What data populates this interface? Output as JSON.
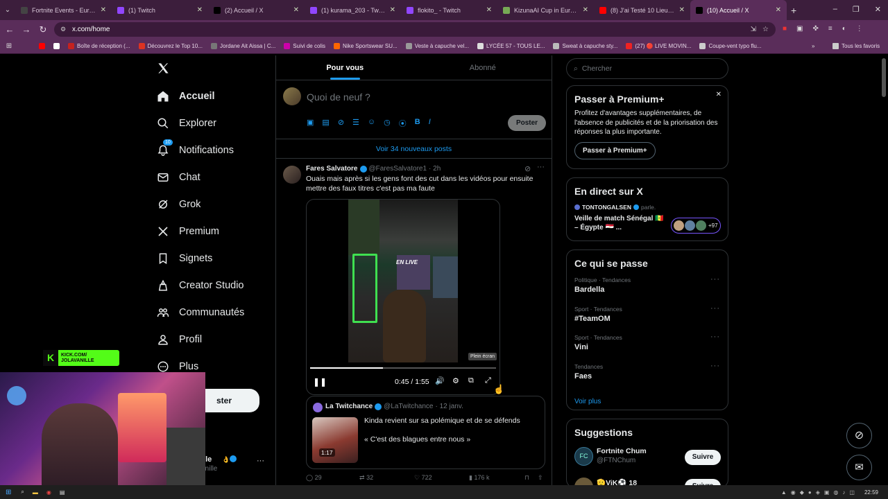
{
  "browser": {
    "tabs": [
      {
        "title": "Fortnite Events - Europe",
        "color": "#444"
      },
      {
        "title": "(1) Twitch",
        "color": "#9146ff"
      },
      {
        "title": "(2) Accueil / X",
        "color": "#000"
      },
      {
        "title": "(1) kurama_203 - Twitch",
        "color": "#9146ff"
      },
      {
        "title": "flokito_ - Twitch",
        "color": "#9146ff"
      },
      {
        "title": "KizunaAI Cup in Europe: 5",
        "color": "#7a5"
      },
      {
        "title": "(8) J'ai Testé 10 Lieux Not",
        "color": "#f00"
      },
      {
        "title": "(10) Accueil / X",
        "color": "#000"
      }
    ],
    "url": "x.com/home",
    "bookmarks": [
      "Boîte de réception (...",
      "Découvrez le Top 10...",
      "Jordane Ait Aissa | C...",
      "Suivi de colis",
      "Nike Sportswear SU...",
      "Veste à capuche vel...",
      "LYCÉE 57 - TOUS LE...",
      "Sweat à capuche sty...",
      "(27) 🔴 LIVE MOVIN...",
      "Coupe-vent typo flu..."
    ],
    "bookmarks_all": "Tous les favoris"
  },
  "nav": {
    "items": [
      {
        "label": "Accueil"
      },
      {
        "label": "Explorer"
      },
      {
        "label": "Notifications"
      },
      {
        "label": "Chat"
      },
      {
        "label": "Grok"
      },
      {
        "label": "Premium"
      },
      {
        "label": "Signets"
      },
      {
        "label": "Creator Studio"
      },
      {
        "label": "Communautés"
      },
      {
        "label": "Profil"
      },
      {
        "label": "Plus"
      }
    ],
    "notif_badge": "10",
    "post_button": "ster",
    "account_name": "ille",
    "account_handle": "anille"
  },
  "feed": {
    "tab_for_you": "Pour vous",
    "tab_following": "Abonné",
    "compose_placeholder": "Quoi de neuf ?",
    "post_button": "Poster",
    "new_posts": "Voir 34 nouveaux posts",
    "tweet": {
      "name": "Fares Salvatore",
      "handle": "@FaresSalvatore1",
      "time": "· 2h",
      "text": "Ouais mais après si les gens font des cut dans les vidéos pour ensuite mettre des faux titres c'est pas ma faute",
      "video_time": "0:45 / 1:55",
      "video_progress": 0.39,
      "tooltip": "Plein écran",
      "video_overlay": "EN LIVE",
      "quote": {
        "name": "La Twitchance",
        "handle": "@LaTwitchance",
        "date": "· 12 janv.",
        "line1": "Kinda revient sur sa polémique et de se défends",
        "line2": "« C'est des blagues entre nous »",
        "duration": "1:17"
      },
      "stats": {
        "replies": "29",
        "reposts": "32",
        "likes": "722",
        "views": "176 k"
      }
    }
  },
  "right": {
    "search_placeholder": "Chercher",
    "premium": {
      "title": "Passer à Premium+",
      "text": "Profitez d'avantages supplémentaires, de l'absence de publicités et de la priorisation des réponses la plus importante.",
      "button": "Passer à Premium+"
    },
    "live": {
      "title": "En direct sur X",
      "host": "TONTONGALSEN",
      "host_suffix": "parle.",
      "topic": "Veille de match Sénégal 🇸🇳 – Égypte 🇪🇬 ...",
      "count": "+97"
    },
    "trends": {
      "title": "Ce qui se passe",
      "items": [
        {
          "meta": "Politique · Tendances",
          "name": "Bardella"
        },
        {
          "meta": "Sport · Tendances",
          "name": "#TeamOM"
        },
        {
          "meta": "Sport · Tendances",
          "name": "Vini"
        },
        {
          "meta": "Tendances",
          "name": "Faes"
        }
      ],
      "more": "Voir plus"
    },
    "suggestions": {
      "title": "Suggestions",
      "items": [
        {
          "name": "Fortnite Chum",
          "handle": "@FTNChum",
          "button": "Suivre"
        },
        {
          "name": "🫡ViK⚽ 18",
          "handle": "",
          "button": "Suivre"
        }
      ]
    }
  },
  "overlay": {
    "kick_line1": "KICK.COM/",
    "kick_line2": "JOLAVANILLE"
  },
  "taskbar": {
    "time": "22:59"
  }
}
